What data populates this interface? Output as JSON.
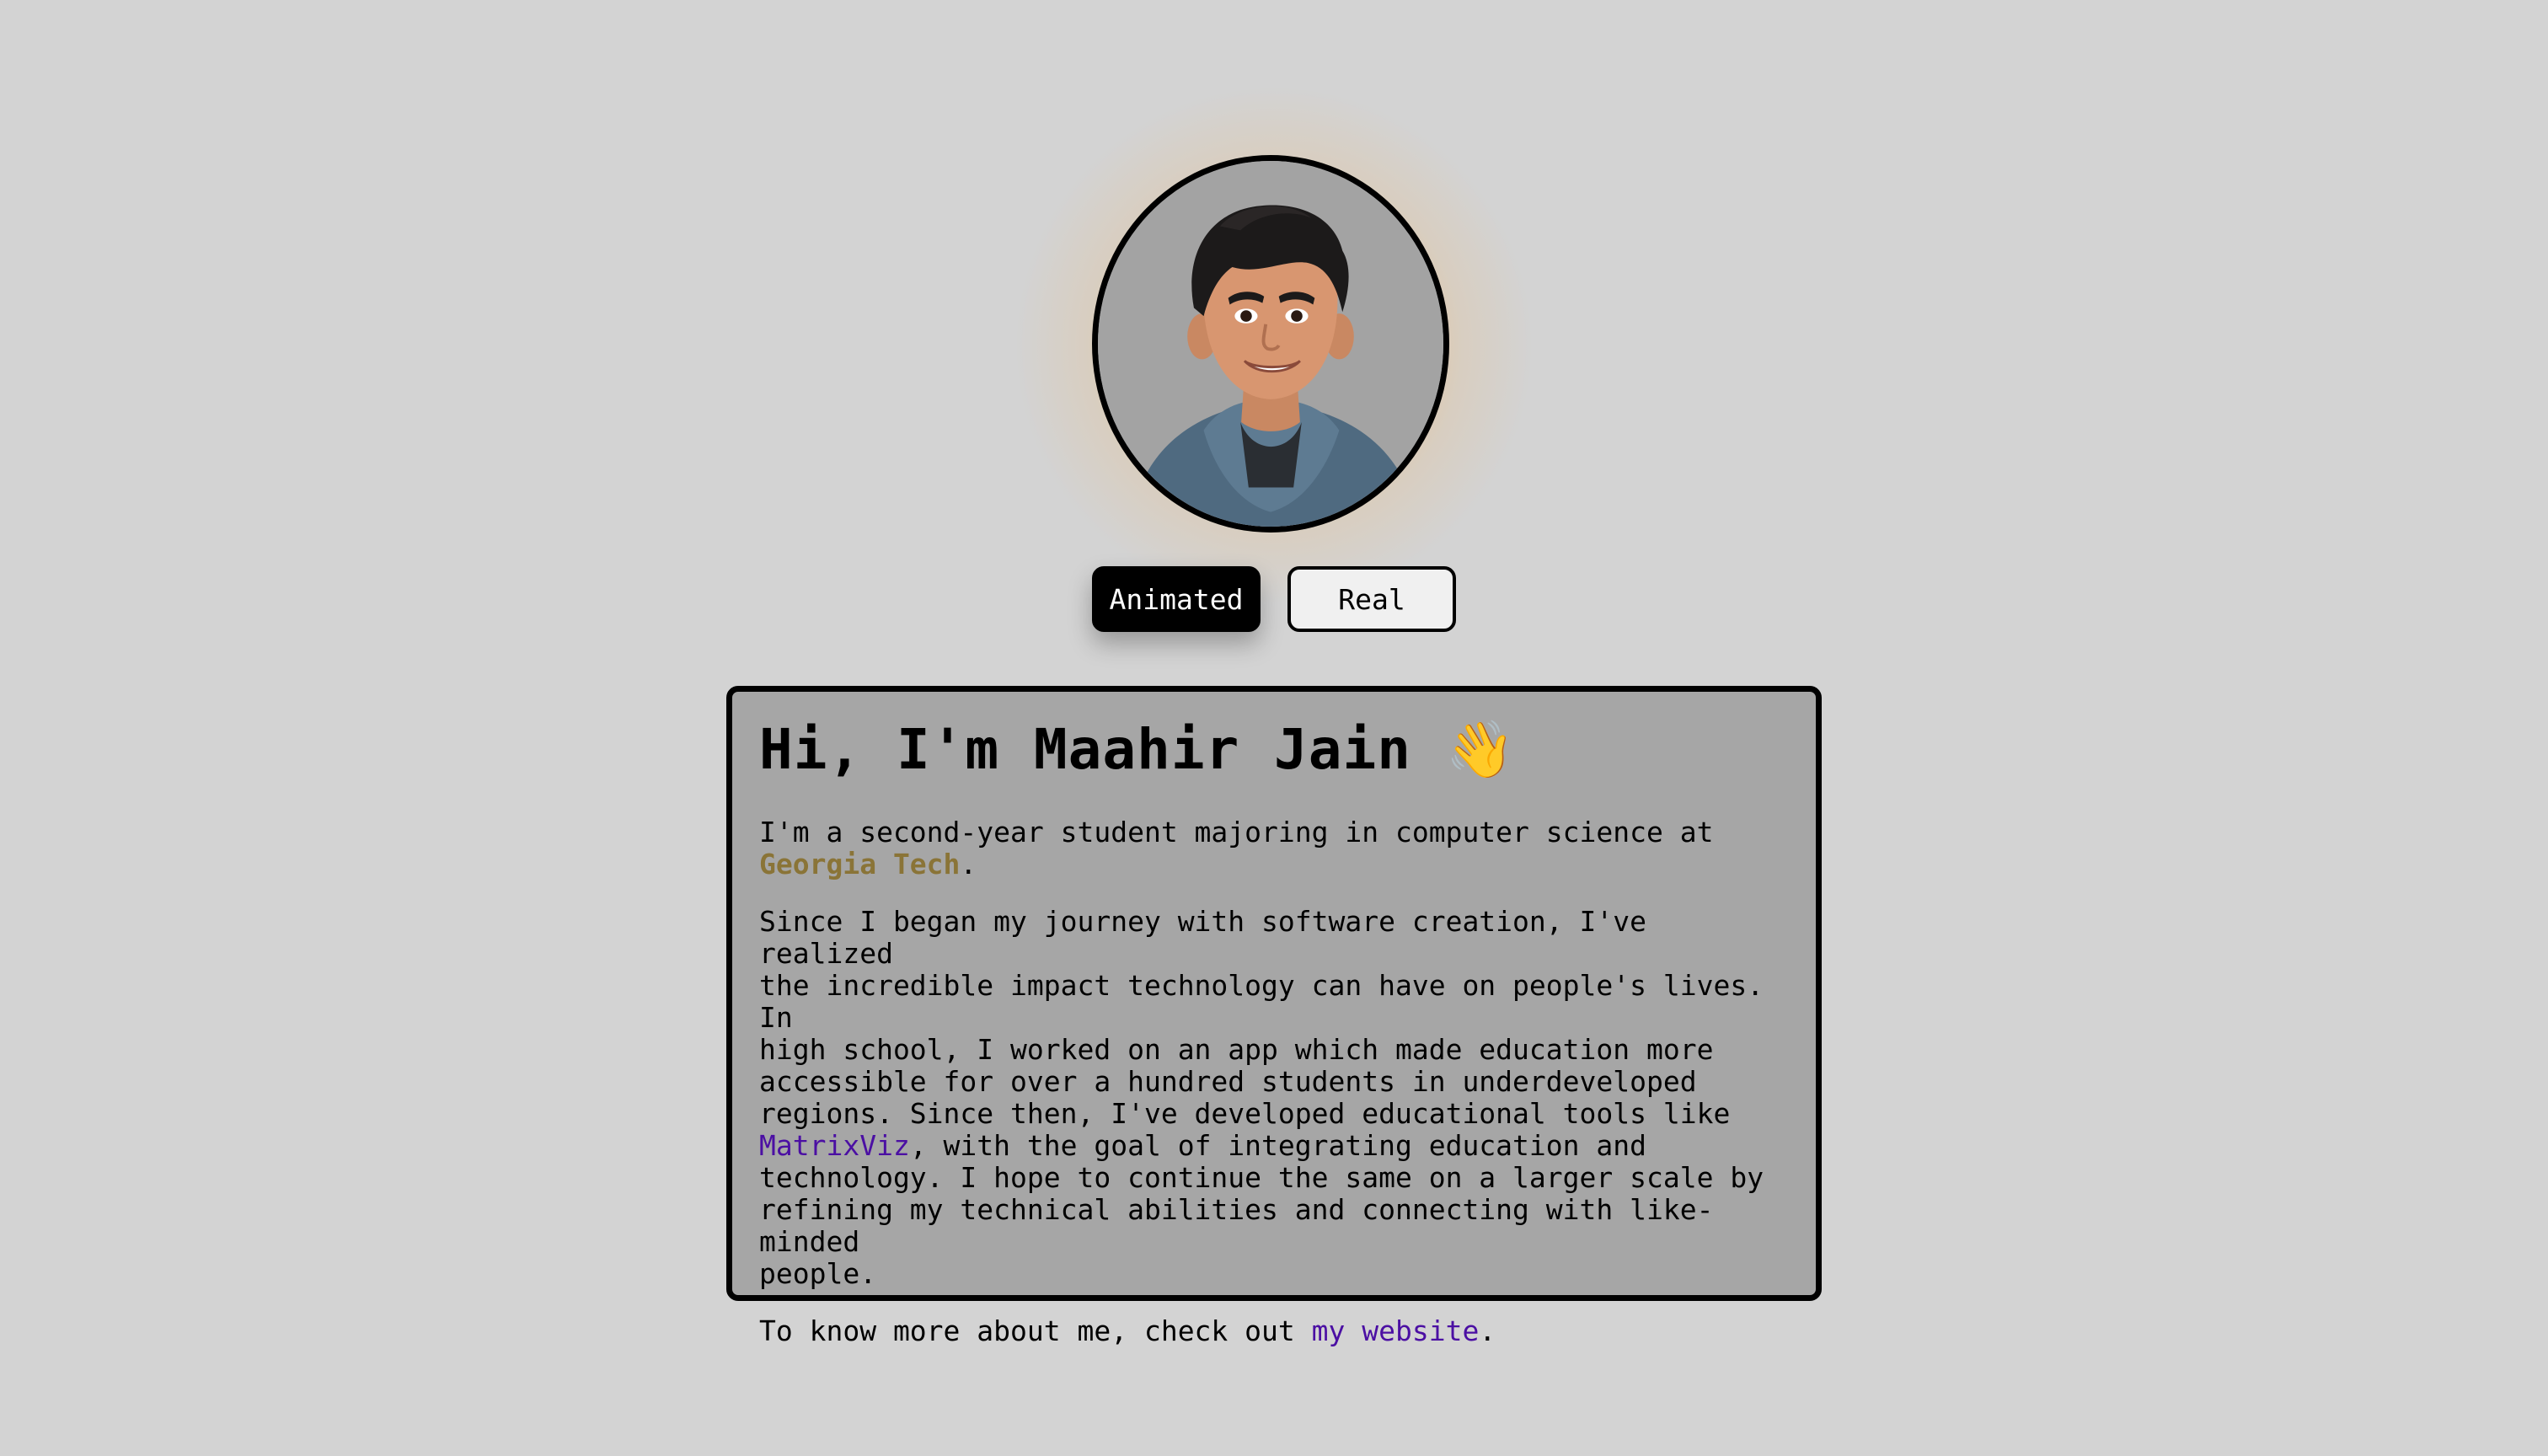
{
  "profile": {
    "avatar_alt": "Animated avatar of Maahir Jain"
  },
  "toggle": {
    "animated_label": "Animated",
    "real_label": "Real",
    "selected": "Animated"
  },
  "intro": {
    "heading": "Hi, I'm Maahir Jain",
    "wave_emoji": "👋",
    "p1_before": "I'm a second-year student majoring in computer science at\n",
    "p1_link": "Georgia Tech",
    "p1_after": ".",
    "p2_before": "Since I began my journey with software creation, I've realized\nthe incredible impact technology can have on people's lives. In\nhigh school, I worked on an app which made education more\naccessible for over a hundred students in underdeveloped\nregions. Since then, I've developed educational tools like\n",
    "p2_link": "MatrixViz",
    "p2_after": ", with the goal of integrating education and\ntechnology. I hope to continue the same on a larger scale by\nrefining my technical abilities and connecting with like-minded\npeople.",
    "p3_before": "To know more about me, check out ",
    "p3_link": "my website",
    "p3_after": "."
  },
  "colors": {
    "background": "#d3d3d3",
    "card": "#a6a6a6",
    "georgia_tech": "#8a7437",
    "link": "#4b0fa3",
    "glow": "#ffaa3c"
  }
}
